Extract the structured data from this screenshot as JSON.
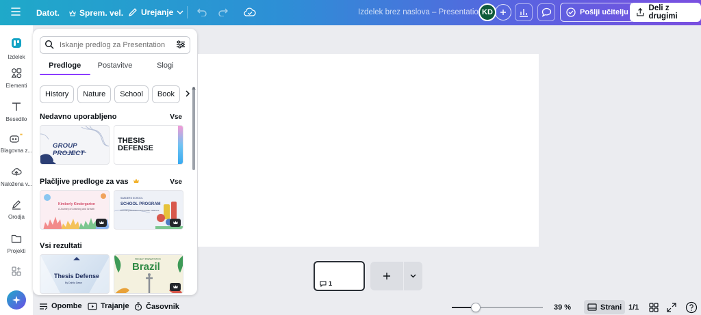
{
  "topbar": {
    "menu_icon": "hamburger-icon",
    "file_label": "Datot.",
    "resize_label": "Sprem. vel.",
    "edit_label": "Urejanje",
    "doc_title": "Izdelek brez naslova – Presentation",
    "avatar_initials": "KD",
    "send_label": "Pošlji učitelju",
    "share_label": "Deli z drugimi"
  },
  "rail": {
    "items": [
      {
        "label": "Izdelek",
        "icon": "design-icon"
      },
      {
        "label": "Elementi",
        "icon": "elements-icon"
      },
      {
        "label": "Besedilo",
        "icon": "text-icon"
      },
      {
        "label": "Blagovna z...",
        "icon": "brand-icon"
      },
      {
        "label": "Naložena v...",
        "icon": "upload-icon"
      },
      {
        "label": "Orodja",
        "icon": "tools-icon"
      },
      {
        "label": "Projekti",
        "icon": "folder-icon"
      },
      {
        "label": "",
        "icon": "apps-icon"
      }
    ]
  },
  "panel": {
    "search_placeholder": "Iskanje predlog za Presentation",
    "tabs": [
      "Predloge",
      "Postavitve",
      "Slogi"
    ],
    "chips": [
      "History",
      "Nature",
      "School",
      "Book"
    ],
    "recent_title": "Nedavno uporabljeno",
    "recent_see_all": "Vse",
    "paid_title": "Plačljive predloge za vas",
    "paid_see_all": "Vse",
    "all_title": "Vsi rezultati",
    "thumbs": {
      "group_project_title": "GROUP PROJECT",
      "group_project_sub": "Presented By: Lineta",
      "thesis_title_1": "THESIS",
      "thesis_title_2": "DEFENSE",
      "kinder_title": "Kimberly Kindergarten",
      "kinder_sub": "A Journey of Learning and Growth",
      "school_pre": "SANDERS SCHOOL",
      "school_title": "SCHOOL PROGRAM",
      "school_sub": "Enriching Education and Growth Initiatives",
      "thesis2_title": "Thesis Defense",
      "thesis2_sub": "By Dahlia Dawn",
      "brazil_pre": "PROJECT PRESENTATION",
      "brazil_title": "Brazil"
    }
  },
  "canvas": {
    "page_comment_count": "1"
  },
  "bottombar": {
    "notes_label": "Opombe",
    "duration_label": "Trajanje",
    "timer_label": "Časovnik",
    "zoom_label": "39 %",
    "zoom_value": 0.39,
    "pages_label": "Strani",
    "page_count": "1/1"
  },
  "colors": {
    "accent": "#8b3dff",
    "topbar_gradient_start": "#1fa9c9",
    "topbar_gradient_end": "#7a4fe0"
  }
}
